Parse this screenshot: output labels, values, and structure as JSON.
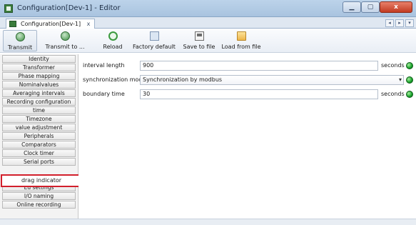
{
  "window": {
    "title": "Configuration[Dev-1] - Editor",
    "minimize_glyph": "▁",
    "maximize_glyph": "▢",
    "close_glyph": "x"
  },
  "tabs": {
    "document_tab_label": "Configuration[Dev-1]",
    "close_glyph": "x",
    "nav_prev": "◂",
    "nav_next": "▸",
    "nav_menu": "▾"
  },
  "toolbar": {
    "transmit": "Transmit",
    "transmit_to": "Transmit to ...",
    "reload": "Reload",
    "factory_default": "Factory default",
    "save_to_file": "Save to file",
    "load_from_file": "Load from file"
  },
  "sidebar": {
    "items": [
      "Identity",
      "Transformer",
      "Phase mapping",
      "Nominalvalues",
      "Averaging intervals",
      "Recording configuration",
      "time",
      "Timezone",
      "value adjustment",
      "Peripherals",
      "Comparators",
      "Clock timer",
      "Serial ports"
    ],
    "highlighted": "drag indicator",
    "items_after": [
      "Ed settings",
      "I/O naming",
      "Online recording"
    ]
  },
  "main": {
    "rows": [
      {
        "label": "interval length",
        "value": "900",
        "unit": "seconds"
      },
      {
        "label": "synchronization mode",
        "value": "Synchronization by modbus",
        "unit": ""
      },
      {
        "label": "boundary time",
        "value": "30",
        "unit": "seconds"
      }
    ]
  },
  "colors": {
    "highlight": "#d21f2b",
    "status_ok": "#17a12a"
  }
}
